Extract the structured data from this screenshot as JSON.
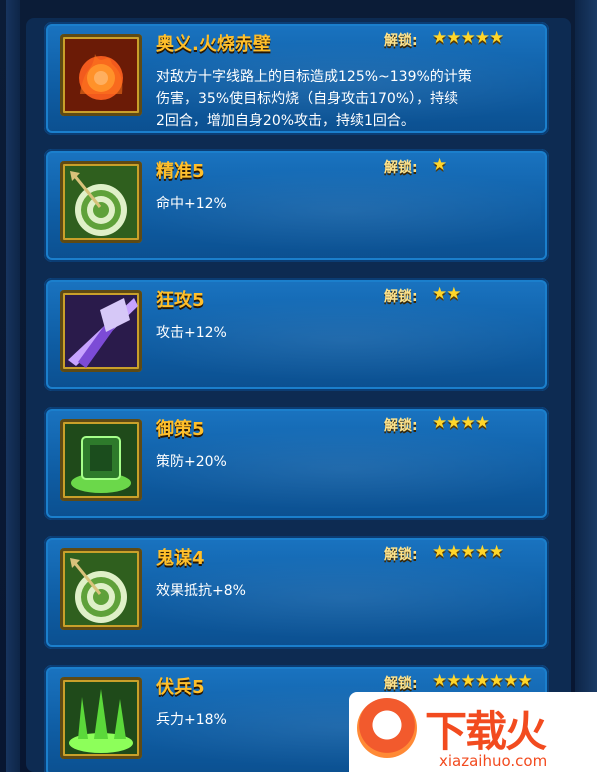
{
  "skills": [
    {
      "name": "奥义.火烧赤壁",
      "unlock_label": "解锁:",
      "stars": "★★★★★",
      "desc_lines": [
        "对敌方十字线路上的目标造成125%~139%的计策",
        "伤害，35%使目标灼烧（自身攻击170%），持续",
        "2回合，增加自身20%攻击，持续1回合。"
      ],
      "icon": "fire-icon"
    },
    {
      "name": "精准5",
      "unlock_label": "解锁:",
      "stars": "★",
      "desc_lines": [
        "命中+12%"
      ],
      "icon": "target-arrow-icon"
    },
    {
      "name": "狂攻5",
      "unlock_label": "解锁:",
      "stars": "★★",
      "desc_lines": [
        "攻击+12%"
      ],
      "icon": "slash-icon"
    },
    {
      "name": "御策5",
      "unlock_label": "解锁:",
      "stars": "★★★★",
      "desc_lines": [
        "策防+20%"
      ],
      "icon": "shield-icon"
    },
    {
      "name": "鬼谋4",
      "unlock_label": "解锁:",
      "stars": "★★★★★",
      "desc_lines": [
        "效果抵抗+8%"
      ],
      "icon": "target-arrow-icon"
    },
    {
      "name": "伏兵5",
      "unlock_label": "解锁:",
      "stars": "★★★★★★★",
      "desc_lines": [
        "兵力+18%"
      ],
      "icon": "troops-icon"
    }
  ],
  "watermark": {
    "cn": "下载火",
    "en": "xiazaihuo.com"
  },
  "colors": {
    "accent": "#ffbf2a",
    "panel": "#0f5ea5",
    "border": "#1b7fcc"
  }
}
